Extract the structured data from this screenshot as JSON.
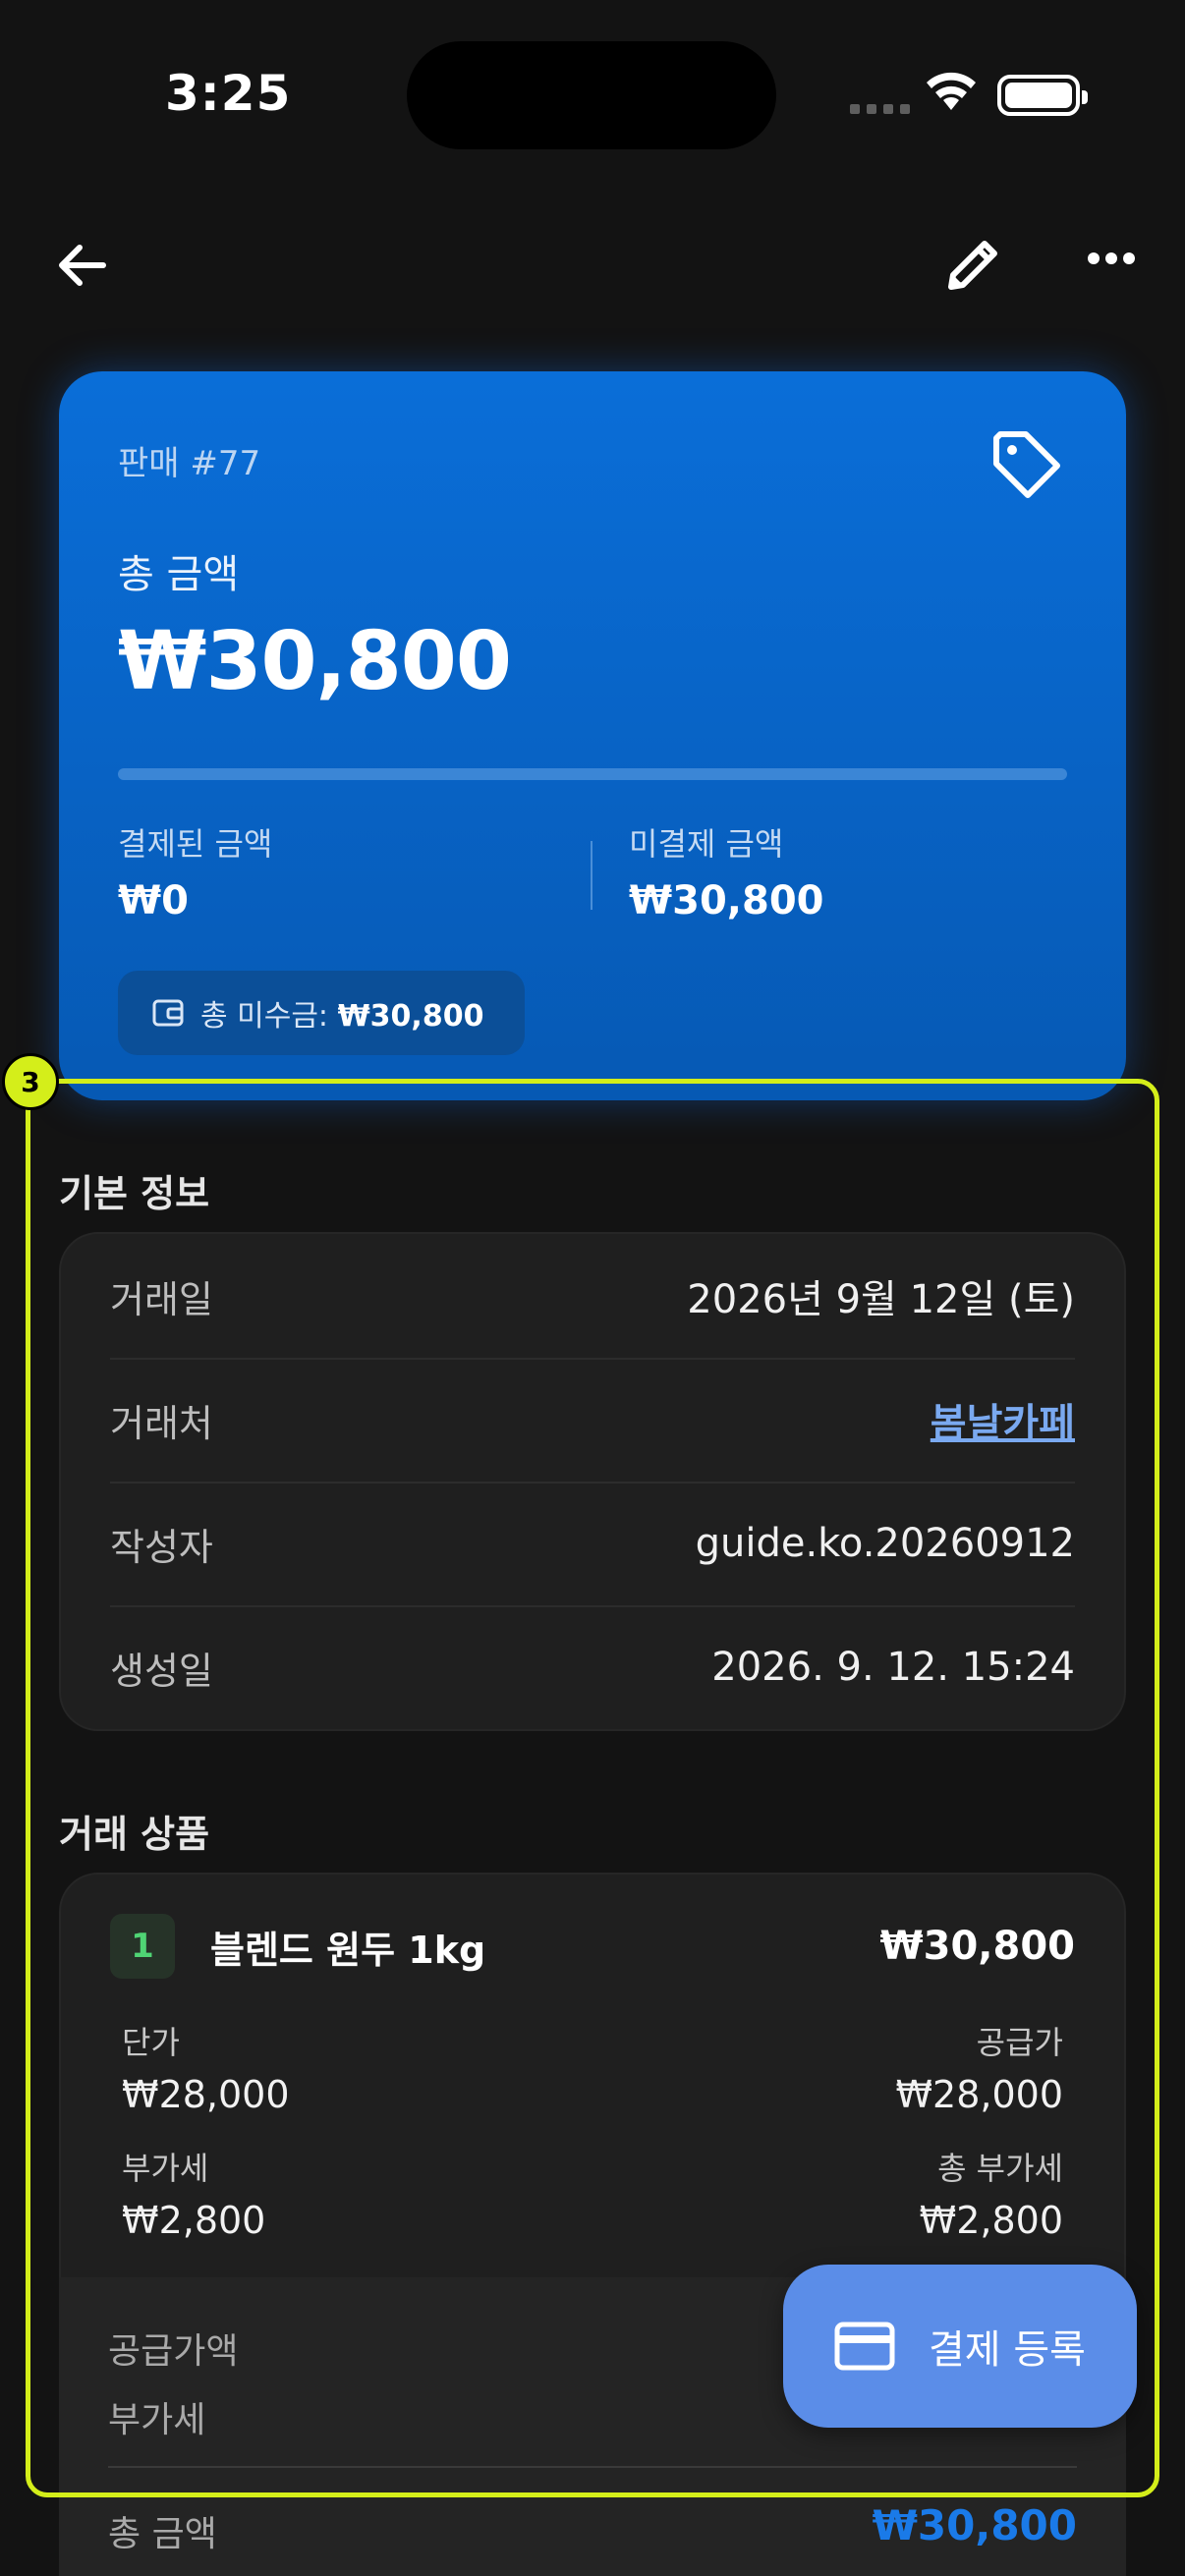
{
  "status_bar": {
    "time": "3:25"
  },
  "hero": {
    "sale_no": "판매 #77",
    "total_label": "총 금액",
    "total_value": "₩30,800",
    "paid_fraction": 0,
    "paid_label": "결제된 금액",
    "paid_value": "₩0",
    "unpaid_label": "미결제 금액",
    "unpaid_value": "₩30,800",
    "receivable_label": "총 미수금:",
    "receivable_value": "₩30,800"
  },
  "highlight_badge": "3",
  "basic_info": {
    "title": "기본 정보",
    "rows": [
      {
        "key": "거래일",
        "value": "2026년 9월 12일 (토)"
      },
      {
        "key": "거래처",
        "value": "봄날카페"
      },
      {
        "key": "작성자",
        "value": "guide.ko.20260912"
      },
      {
        "key": "생성일",
        "value": "2026. 9. 12. 15:24"
      }
    ]
  },
  "products": {
    "title": "거래 상품",
    "items": [
      {
        "index": "1",
        "name": "블렌드 원두 1kg",
        "price": "₩30,800",
        "unit_price_label": "단가",
        "unit_price": "₩28,000",
        "supply_label": "공급가",
        "supply": "₩28,000",
        "vat_label": "부가세",
        "vat": "₩2,800",
        "total_vat_label": "총 부가세",
        "total_vat": "₩2,800"
      }
    ],
    "summary": {
      "supply_total_label": "공급가액",
      "vat_label": "부가세",
      "total_label": "총 금액",
      "total_value": "₩30,800"
    }
  },
  "fab": {
    "label": "결제 등록"
  },
  "colors": {
    "accent": "#0a6ed8",
    "highlight": "#d4ee1a",
    "link": "#7aa9f0",
    "fab": "#5b8de8"
  }
}
